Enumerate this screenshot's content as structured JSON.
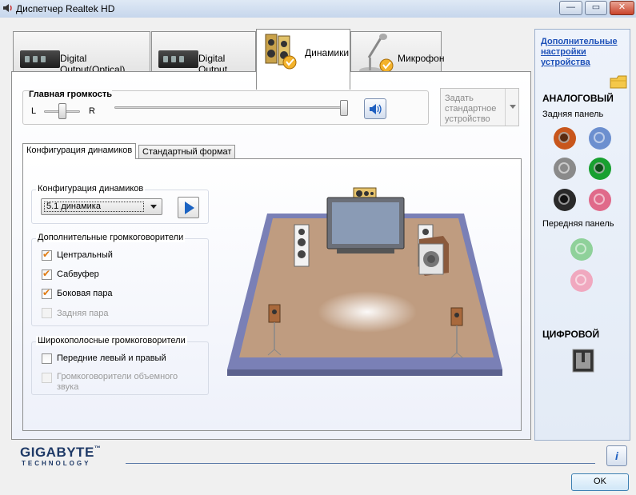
{
  "window": {
    "title": "Диспетчер Realtek HD",
    "minimize": "—",
    "maximize": "▭",
    "close": "✕"
  },
  "tabs": [
    {
      "label": "Digital Output(Optical)",
      "active": false
    },
    {
      "label": "Digital Output",
      "active": false
    },
    {
      "label": "Динамики",
      "active": true
    },
    {
      "label": "Микрофон",
      "active": false
    }
  ],
  "volume": {
    "title": "Главная громкость",
    "left": "L",
    "right": "R",
    "balance": 0.5,
    "level": 1.0,
    "speaker_icon": "speaker-volume-icon"
  },
  "default_device": {
    "label": "Задать стандартное устройство"
  },
  "inner_tabs": [
    {
      "label": "Конфигурация динамиков",
      "active": true
    },
    {
      "label": "Стандартный формат",
      "active": false
    }
  ],
  "config": {
    "group_title": "Конфигурация динамиков",
    "selected": "5.1 динамика",
    "play_icon": "play-icon"
  },
  "extra_speakers": {
    "title": "Дополнительные громкоговорители",
    "items": [
      {
        "label": "Центральный",
        "checked": true,
        "enabled": true
      },
      {
        "label": "Сабвуфер",
        "checked": true,
        "enabled": true
      },
      {
        "label": "Боковая пара",
        "checked": true,
        "enabled": true
      },
      {
        "label": "Задняя пара",
        "checked": false,
        "enabled": false
      }
    ]
  },
  "fullrange": {
    "title": "Широкополосные громкоговорители",
    "items": [
      {
        "label": "Передние левый и правый",
        "checked": false,
        "enabled": true
      },
      {
        "label": "Громкоговорители объемного звука",
        "checked": false,
        "enabled": false
      }
    ]
  },
  "sidebar": {
    "link": "Дополнительные настройки устройства",
    "analog_title": "АНАЛОГОВЫЙ",
    "rear_panel": "Задняя панель",
    "front_panel": "Передняя панель",
    "digital_title": "ЦИФРОВОЙ",
    "jack_colors": {
      "orange": "#c8561c",
      "blue": "#6c8fcf",
      "gray": "#8a8a8a",
      "green": "#18a030",
      "black": "#2a2a2a",
      "pink": "#e06a8a",
      "front_green": "#8fd19a",
      "front_pink": "#f0a8bf"
    }
  },
  "brand": {
    "name": "GIGABYTE",
    "tm": "™",
    "sub": "TECHNOLOGY"
  },
  "buttons": {
    "info": "i",
    "ok": "OK"
  }
}
